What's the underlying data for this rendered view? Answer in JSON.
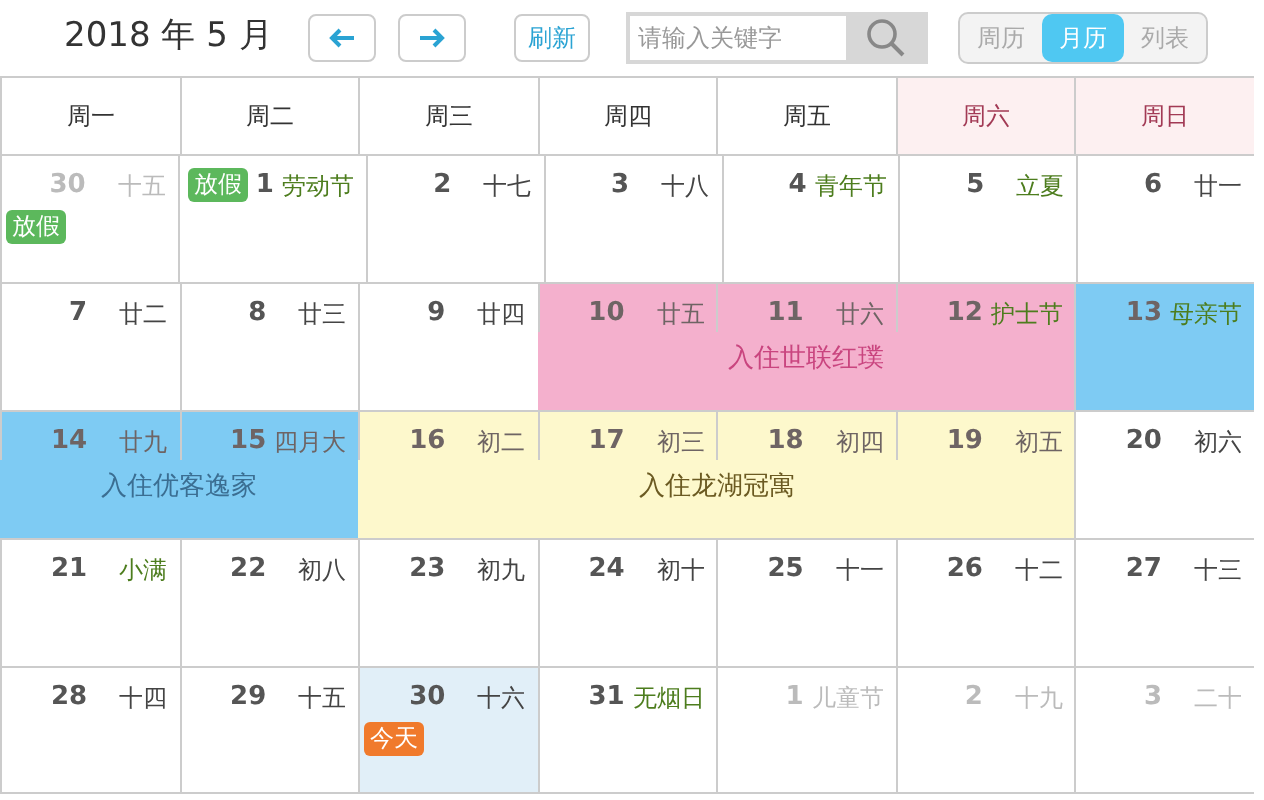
{
  "header": {
    "title": "2018 年 5 月",
    "refresh": "刷新",
    "search": {
      "placeholder": "请输入关键字"
    },
    "views": [
      {
        "label": "周历",
        "selected": false
      },
      {
        "label": "月历",
        "selected": true
      },
      {
        "label": "列表",
        "selected": false
      }
    ]
  },
  "weekdays": [
    {
      "label": "周一",
      "weekend": false
    },
    {
      "label": "周二",
      "weekend": false
    },
    {
      "label": "周三",
      "weekend": false
    },
    {
      "label": "周四",
      "weekend": false
    },
    {
      "label": "周五",
      "weekend": false
    },
    {
      "label": "周六",
      "weekend": true
    },
    {
      "label": "周日",
      "weekend": true
    }
  ],
  "weeks": [
    {
      "segments": [
        {
          "days": [
            {
              "date": "30",
              "lunar": "十五",
              "festival": false,
              "other_month": true,
              "today": false,
              "badge": {
                "text": "放假",
                "kind": "holiday",
                "inline": false
              }
            },
            {
              "date": "1",
              "lunar": "劳动节",
              "festival": true,
              "other_month": false,
              "today": false,
              "badge": {
                "text": "放假",
                "kind": "holiday",
                "inline": true
              }
            },
            {
              "date": "2",
              "lunar": "十七",
              "festival": false,
              "other_month": false,
              "today": false
            },
            {
              "date": "3",
              "lunar": "十八",
              "festival": false,
              "other_month": false,
              "today": false
            },
            {
              "date": "4",
              "lunar": "青年节",
              "festival": true,
              "other_month": false,
              "today": false
            },
            {
              "date": "5",
              "lunar": "立夏",
              "festival": true,
              "other_month": false,
              "today": false
            },
            {
              "date": "6",
              "lunar": "廿一",
              "festival": false,
              "other_month": false,
              "today": false
            }
          ]
        }
      ]
    },
    {
      "segments": [
        {
          "days": [
            {
              "date": "7",
              "lunar": "廿二",
              "festival": false,
              "other_month": false,
              "today": false
            },
            {
              "date": "8",
              "lunar": "廿三",
              "festival": false,
              "other_month": false,
              "today": false
            },
            {
              "date": "9",
              "lunar": "廿四",
              "festival": false,
              "other_month": false,
              "today": false
            }
          ]
        },
        {
          "color": "#f4b0cd",
          "label": "入住世联红璞",
          "days": [
            {
              "date": "10",
              "lunar": "廿五",
              "festival": false,
              "other_month": false,
              "today": false
            },
            {
              "date": "11",
              "lunar": "廿六",
              "festival": false,
              "other_month": false,
              "today": false
            },
            {
              "date": "12",
              "lunar": "护士节",
              "festival": true,
              "other_month": false,
              "today": false
            }
          ]
        },
        {
          "color": "#7ecbf3",
          "days": [
            {
              "date": "13",
              "lunar": "母亲节",
              "festival": true,
              "other_month": false,
              "today": false
            }
          ]
        }
      ]
    },
    {
      "segments": [
        {
          "color": "#7ecbf3",
          "label": "入住优客逸家",
          "days": [
            {
              "date": "14",
              "lunar": "廿九",
              "festival": false,
              "other_month": false,
              "today": false
            },
            {
              "date": "15",
              "lunar": "四月大",
              "festival": false,
              "other_month": false,
              "today": false
            }
          ]
        },
        {
          "color": "#fdf8cc",
          "label": "入住龙湖冠寓",
          "days": [
            {
              "date": "16",
              "lunar": "初二",
              "festival": false,
              "other_month": false,
              "today": false
            },
            {
              "date": "17",
              "lunar": "初三",
              "festival": false,
              "other_month": false,
              "today": false
            },
            {
              "date": "18",
              "lunar": "初四",
              "festival": false,
              "other_month": false,
              "today": false
            },
            {
              "date": "19",
              "lunar": "初五",
              "festival": false,
              "other_month": false,
              "today": false
            }
          ]
        },
        {
          "days": [
            {
              "date": "20",
              "lunar": "初六",
              "festival": false,
              "other_month": false,
              "today": false
            }
          ]
        }
      ]
    },
    {
      "segments": [
        {
          "days": [
            {
              "date": "21",
              "lunar": "小满",
              "festival": true,
              "other_month": false,
              "today": false
            },
            {
              "date": "22",
              "lunar": "初八",
              "festival": false,
              "other_month": false,
              "today": false
            },
            {
              "date": "23",
              "lunar": "初九",
              "festival": false,
              "other_month": false,
              "today": false
            },
            {
              "date": "24",
              "lunar": "初十",
              "festival": false,
              "other_month": false,
              "today": false
            },
            {
              "date": "25",
              "lunar": "十一",
              "festival": false,
              "other_month": false,
              "today": false
            },
            {
              "date": "26",
              "lunar": "十二",
              "festival": false,
              "other_month": false,
              "today": false
            },
            {
              "date": "27",
              "lunar": "十三",
              "festival": false,
              "other_month": false,
              "today": false
            }
          ]
        }
      ]
    },
    {
      "segments": [
        {
          "days": [
            {
              "date": "28",
              "lunar": "十四",
              "festival": false,
              "other_month": false,
              "today": false
            },
            {
              "date": "29",
              "lunar": "十五",
              "festival": false,
              "other_month": false,
              "today": false
            },
            {
              "date": "30",
              "lunar": "十六",
              "festival": false,
              "other_month": false,
              "today": true,
              "badge": {
                "text": "今天",
                "kind": "today",
                "inline": false
              }
            },
            {
              "date": "31",
              "lunar": "无烟日",
              "festival": true,
              "other_month": false,
              "today": false
            },
            {
              "date": "1",
              "lunar": "儿童节",
              "festival": true,
              "other_month": true,
              "today": false
            },
            {
              "date": "2",
              "lunar": "十九",
              "festival": false,
              "other_month": true,
              "today": false
            },
            {
              "date": "3",
              "lunar": "二十",
              "festival": false,
              "other_month": true,
              "today": false
            }
          ]
        }
      ]
    }
  ]
}
